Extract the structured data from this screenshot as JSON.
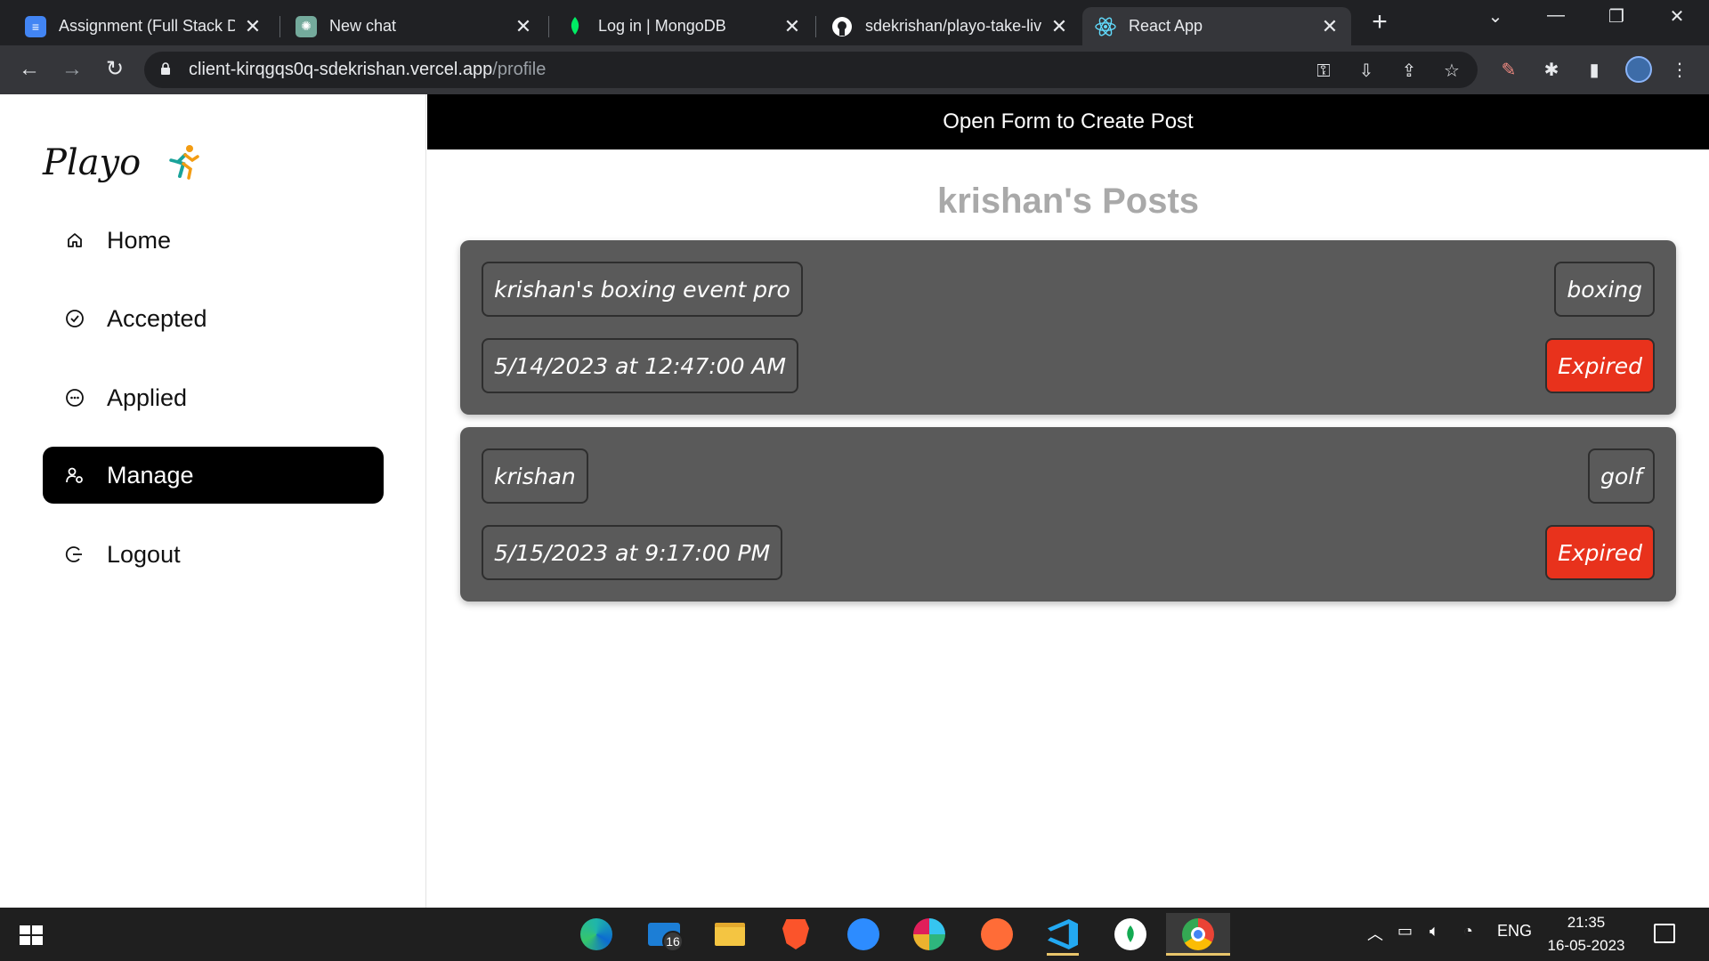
{
  "browser": {
    "tabs": [
      {
        "title": "Assignment (Full Stack De",
        "favicon": "docs-icon",
        "color": "#4285f4",
        "active": false
      },
      {
        "title": "New chat",
        "favicon": "openai-icon",
        "color": "#74aa9c",
        "active": false
      },
      {
        "title": "Log in | MongoDB",
        "favicon": "mongodb-leaf-icon",
        "color": "#00ed64",
        "active": false
      },
      {
        "title": "sdekrishan/playo-take-liv",
        "favicon": "github-icon",
        "color": "#ffffff",
        "active": false
      },
      {
        "title": "React App",
        "favicon": "react-icon",
        "color": "#61dafb",
        "active": true
      }
    ],
    "address": {
      "host": "client-kirqgqs0q-sdekrishan.vercel.app",
      "path": "/profile"
    }
  },
  "sidebar": {
    "logo_text": "Playo",
    "items": [
      {
        "label": "Home",
        "icon": "home-icon",
        "active": false
      },
      {
        "label": "Accepted",
        "icon": "check-circle-icon",
        "active": false
      },
      {
        "label": "Applied",
        "icon": "dots-circle-icon",
        "active": false
      },
      {
        "label": "Manage",
        "icon": "users-cog-icon",
        "active": true
      },
      {
        "label": "Logout",
        "icon": "logout-icon",
        "active": false
      }
    ]
  },
  "main": {
    "create_button": "Open Form to Create Post",
    "posts_title": "krishan's Posts",
    "posts": [
      {
        "name": "krishan's boxing event pro",
        "sport": "boxing",
        "datetime": "5/14/2023 at 12:47:00 AM",
        "status": "Expired"
      },
      {
        "name": "krishan",
        "sport": "golf",
        "datetime": "5/15/2023 at 9:17:00 PM",
        "status": "Expired"
      }
    ]
  },
  "taskbar": {
    "mail_badge": "16",
    "language": "ENG",
    "time": "21:35",
    "date": "16-05-2023"
  },
  "colors": {
    "status_expired": "#e8321c",
    "card_bg": "#5a5a5a",
    "accent_black": "#000000"
  }
}
